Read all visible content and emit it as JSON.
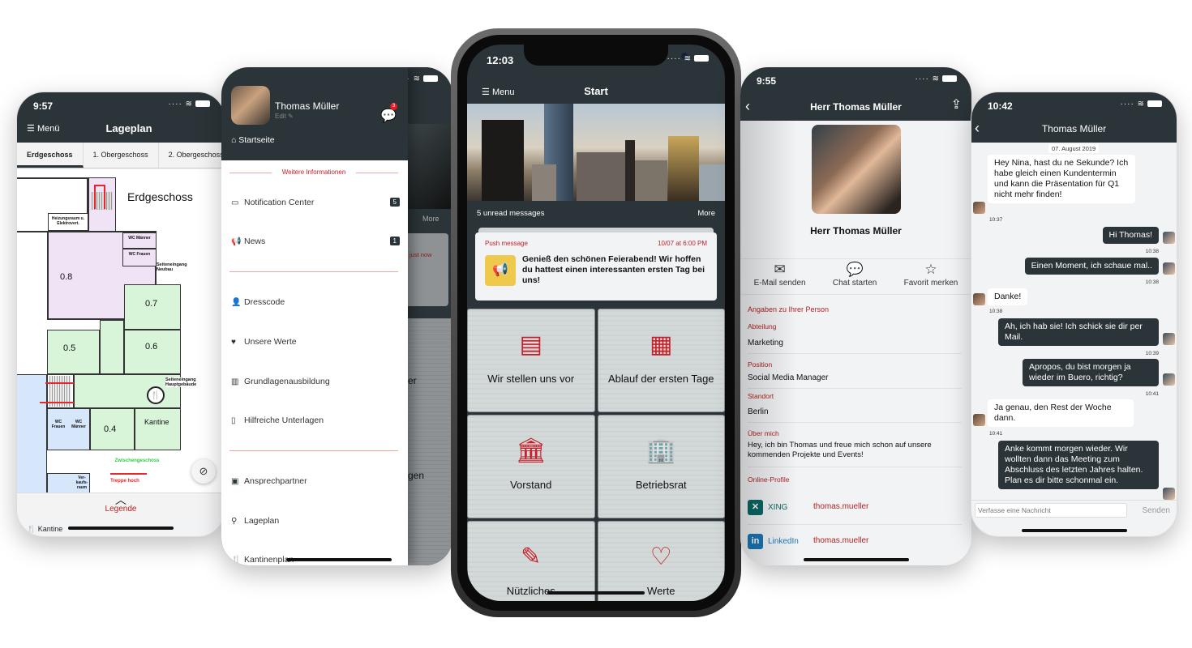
{
  "phones": {
    "lageplan": {
      "status_time": "9:57",
      "menu_label": "Menü",
      "title": "Lageplan",
      "tabs": [
        {
          "label": "Erdgeschoss",
          "active": true
        },
        {
          "label": "1. Obergeschoss",
          "active": false
        },
        {
          "label": "2. Obergeschoss",
          "active": false
        }
      ],
      "map": {
        "floor_title": "Erdgeschoss",
        "rooms": [
          "0.8",
          "0.7",
          "0.5",
          "0.6",
          "0.4",
          "Kantine"
        ],
        "small_labels": {
          "heizung": "Heizungsraum u. Elektrovert.",
          "wc_maenner_top": "WC Männer",
          "wc_frauen_top": "WC Frauen",
          "seiteneingang_neubau": "Seiteneingang Neubau",
          "seiteneingang_haupt": "Seiteneingang Hauptgebäude",
          "wc_frauen_bottom": "WC Frauen",
          "wc_maenner_bottom": "WC Männer",
          "verkaufsraum": "Ver-kaufs-raum",
          "zwischengeschoss": "Zwischengeschoss",
          "treppe_hoch": "Treppe hoch"
        },
        "colors": {
          "purple": "#efe3f5",
          "green": "#d9f5d9",
          "blue": "#d6e6fb",
          "red": "#e8262c"
        }
      },
      "legend_label": "Legende",
      "legend_first_item": "Kantine"
    },
    "sidemenu": {
      "user_name": "Thomas Müller",
      "edit_label": "Edit",
      "chat_badge": "3",
      "home_item": "Startseite",
      "section_title": "Weitere Informationen",
      "items_group1": [
        {
          "label": "Notification Center",
          "icon": "inbox-icon",
          "count": "5"
        },
        {
          "label": "News",
          "icon": "megaphone-icon",
          "count": "1"
        }
      ],
      "items_group2": [
        {
          "label": "Dresscode",
          "icon": "user-tie-icon"
        },
        {
          "label": "Unsere Werte",
          "icon": "heart-icon"
        },
        {
          "label": "Grundlagenausbildung",
          "icon": "books-icon"
        },
        {
          "label": "Hilfreiche Unterlagen",
          "icon": "document-icon"
        }
      ],
      "items_group3": [
        {
          "label": "Ansprechpartner",
          "icon": "address-book-icon"
        },
        {
          "label": "Lageplan",
          "icon": "map-marker-icon"
        },
        {
          "label": "Kantinenplan",
          "icon": "cutlery-icon"
        }
      ],
      "behind": {
        "more": "More",
        "just_now": "just now",
        "partial1": "er",
        "partial2": "gen"
      }
    },
    "start": {
      "status_time": "12:03",
      "menu_label": "Menu",
      "title": "Start",
      "unread": "5 unread messages",
      "more": "More",
      "push": {
        "label": "Push message",
        "time": "10/07 at 6:00 PM",
        "message": "Genieß den schönen Feierabend! Wir hoffen du hattest einen interessanten ersten Tag bei uns!"
      },
      "tiles": [
        {
          "label": "Wir stellen uns vor",
          "icon": "id-card-icon",
          "glyph": "🪪"
        },
        {
          "label": "Ablauf der ersten Tage",
          "icon": "calendar-icon",
          "glyph": "📆"
        },
        {
          "label": "Vorstand",
          "icon": "building-icon",
          "glyph": "🏛"
        },
        {
          "label": "Betriebsrat",
          "icon": "office-person-icon",
          "glyph": "🏢"
        },
        {
          "label": "Nützliches",
          "icon": "checklist-pen-icon",
          "glyph": "📝"
        },
        {
          "label": "Werte",
          "icon": "heart-hand-icon",
          "glyph": "♡"
        }
      ],
      "accent": "#c81e28"
    },
    "profile": {
      "status_time": "9:55",
      "title": "Herr Thomas Müller",
      "name": "Herr Thomas Müller",
      "actions": [
        {
          "label": "E-Mail senden",
          "icon": "envelope-icon"
        },
        {
          "label": "Chat starten",
          "icon": "chat-bubble-icon"
        },
        {
          "label": "Favorit merken",
          "icon": "star-icon"
        }
      ],
      "section": "Angaben zu Ihrer Person",
      "fields": [
        {
          "label": "Abteilung",
          "value": "Marketing"
        },
        {
          "label": "Position",
          "value": "Social Media Manager"
        },
        {
          "label": "Standort",
          "value": "Berlin"
        },
        {
          "label": "Über mich",
          "value": "Hey, ich bin Thomas und freue mich schon auf unsere kommenden Projekte und Events!"
        }
      ],
      "online_title": "Online-Profile",
      "profiles": [
        {
          "network": "XING",
          "handle": "thomas.mueller",
          "color": "#0a6866"
        },
        {
          "network": "LinkedIn",
          "handle": "thomas.mueller",
          "color": "#1a78b4"
        }
      ]
    },
    "chat": {
      "status_time": "10:42",
      "title": "Thomas Müller",
      "date": "07. August 2019",
      "messages": [
        {
          "dir": "in",
          "text": "Hey Nina, hast du ne Sekunde? Ich habe gleich einen Kundentermin und kann die Präsentation für Q1 nicht mehr finden!",
          "time": "10:37"
        },
        {
          "dir": "out",
          "text": "Hi Thomas!",
          "time": "10:38"
        },
        {
          "dir": "out",
          "text": "Einen Moment, ich schaue mal..",
          "time": "10:38"
        },
        {
          "dir": "in",
          "text": "Danke!",
          "time": "10:38"
        },
        {
          "dir": "out",
          "text": "Ah, ich hab sie! Ich schick sie dir per Mail.",
          "time": "10:39"
        },
        {
          "dir": "out",
          "text": "Apropos, du bist morgen ja wieder im Buero, richtig?",
          "time": "10:41"
        },
        {
          "dir": "in",
          "text": "Ja genau, den Rest der Woche dann.",
          "time": "10:41"
        },
        {
          "dir": "out",
          "text": "Anke kommt morgen wieder. Wir wollten dann das Meeting zum Abschluss des letzten Jahres halten. Plan es dir bitte schonmal ein.",
          "time": ""
        }
      ],
      "composer_placeholder": "Verfasse eine Nachricht",
      "send_label": "Senden"
    }
  }
}
